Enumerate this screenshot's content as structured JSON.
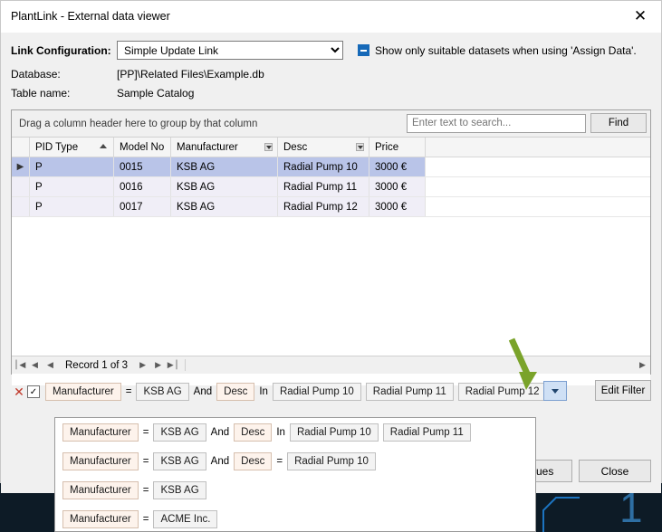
{
  "window": {
    "title": "PlantLink - External data viewer",
    "close_icon": "close-icon"
  },
  "form": {
    "link_configuration_label": "Link Configuration:",
    "link_configuration_value": "Simple Update Link",
    "link_configuration_options": [
      "Simple Update Link"
    ],
    "checkbox_label": "Show only suitable datasets when using 'Assign Data'.",
    "database_label": "Database:",
    "database_value": "[PP]\\Related Files\\Example.db",
    "table_name_label": "Table name:",
    "table_name_value": "Sample Catalog"
  },
  "grid": {
    "group_hint": "Drag a column header here to group by that column",
    "search_placeholder": "Enter text to search...",
    "search_value": "",
    "find_label": "Find",
    "columns": [
      "PID Type",
      "Model No",
      "Manufacturer",
      "Desc",
      "Price"
    ],
    "rows": [
      {
        "indicator": "▶",
        "PID Type": "P",
        "Model No": "0015",
        "Manufacturer": "KSB AG",
        "Desc": "Radial Pump 10",
        "Price": "3000 €"
      },
      {
        "indicator": "",
        "PID Type": "P",
        "Model No": "0016",
        "Manufacturer": "KSB AG",
        "Desc": "Radial Pump 11",
        "Price": "3000 €"
      },
      {
        "indicator": "",
        "PID Type": "P",
        "Model No": "0017",
        "Manufacturer": "KSB AG",
        "Desc": "Radial Pump 12",
        "Price": "3000 €"
      }
    ],
    "navigator": {
      "first": "⎪◀",
      "prev": "◀",
      "prev_page": "◀",
      "record_text": "Record 1 of 3",
      "next": "▶",
      "next_page": "▶",
      "last": "▶⎪",
      "add": "➕"
    }
  },
  "filter_bar": {
    "remove_icon": "✕",
    "enabled_check": "✓",
    "field1": "Manufacturer",
    "op1": "=",
    "value1": "KSB AG",
    "conjunction": "And",
    "field2": "Desc",
    "op2": "In",
    "values2": [
      "Radial Pump 10",
      "Radial Pump 11",
      "Radial Pump 12"
    ],
    "dropdown_icon": "chevron-down-icon",
    "edit_filter_label": "Edit Filter"
  },
  "suggestions": [
    {
      "field1": "Manufacturer",
      "op1": "=",
      "value1": "KSB AG",
      "conjunction": "And",
      "field2": "Desc",
      "op2": "In",
      "values2": [
        "Radial Pump 10",
        "Radial Pump 11"
      ]
    },
    {
      "field1": "Manufacturer",
      "op1": "=",
      "value1": "KSB AG",
      "conjunction": "And",
      "field2": "Desc",
      "op2": "=",
      "values2": [
        "Radial Pump 10"
      ]
    },
    {
      "field1": "Manufacturer",
      "op1": "=",
      "value1": "KSB AG",
      "conjunction": "",
      "field2": "",
      "op2": "",
      "values2": []
    },
    {
      "field1": "Manufacturer",
      "op1": "=",
      "value1": "ACME Inc.",
      "conjunction": "",
      "field2": "",
      "op2": "",
      "values2": []
    }
  ],
  "buttons": {
    "values_label": "...alues",
    "close_label": "Close"
  },
  "background": {
    "number": "1",
    "accent_color": "#1c74c0"
  },
  "colors": {
    "selection": "#b9c4e8",
    "accent_blue": "#1669b8",
    "arrow_green": "#7aa32a",
    "pill_field": "#fdf3ec",
    "pill_value": "#f3f3f3"
  }
}
